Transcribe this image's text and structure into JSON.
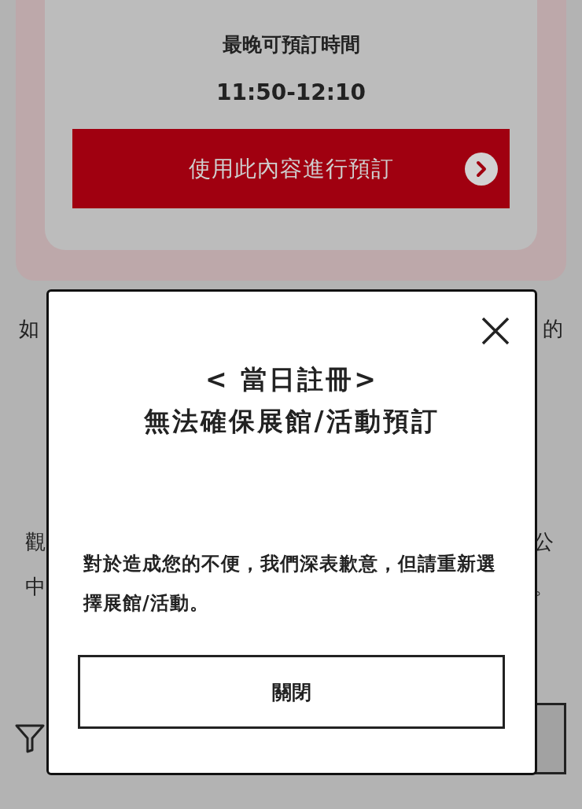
{
  "reservation_card": {
    "latest_time_label": "最晚可預訂時間",
    "latest_time": "11:50-12:10",
    "book_button": "使用此內容進行預訂"
  },
  "background_text": [
    {
      "left": "如",
      "right": "的"
    },
    {
      "left": "觀",
      "right": "公"
    },
    {
      "left": "中",
      "right": "。"
    }
  ],
  "dialog": {
    "title_lines": [
      "< 當日註冊>",
      "無法確保展館/活動預訂"
    ],
    "message": "對於造成您的不便，我們深表歉意，但請重新選擇展館/活動。",
    "close_button": "關閉"
  }
}
